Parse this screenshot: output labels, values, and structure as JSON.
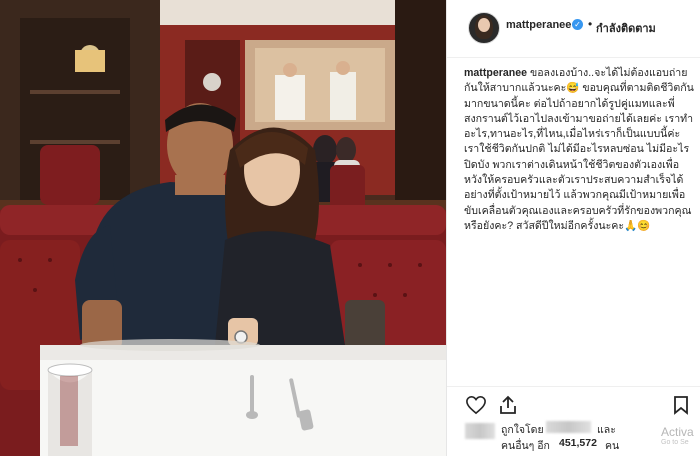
{
  "post": {
    "username": "mattperanee",
    "follow_status": "กำลังติดตาม",
    "caption_user": "mattperanee",
    "caption_lines": [
      "ขอลงเองบ้าง..จะได้ไม่ต้องแอบถ่าย",
      "กันให้สาบากแล้วนะคะ😅 ขอบคุณที่ตามติดชีวิตกัน",
      "มากขนาดนี้คะ ต่อไปถ้าอยากได้รูปคู่แมทและพี่",
      "สงกรานต์ไว้เอาไปลงเข้ามาขอถ่ายได้เลยค่ะ เราทำ",
      "อะไร,ทานอะไร,ที่ไหน,เมื่อไหร่เราก็เป็นแบบนี้ค่ะ",
      "เราใช้ชีวิตกันปกติ ไม่ได้มีอะไรหลบซ่อน ไม่มีอะไร",
      "ปิดบัง พวกเราต่างเดินหน้าใช้ชีวิตของตัวเองเพื่อ",
      "หวังให้ครอบครัวและตัวเราประสบความสำเร็จได้",
      "อย่างที่ตั้งเป้าหมายไว้ แล้วพวกคุณมีเป้าหมายเพื่อ",
      "ขับเคลื่อนตัวคุณเองและครอบครัวที่รักของพวกคุณ",
      "หรือยังคะ? สวัสดีปีใหม่อีกครั้งนะคะ🙏😊"
    ]
  },
  "likes": {
    "line1_prefix": "ถูกใจโดย",
    "line1_suffix": "และ",
    "line2_prefix": "คนอื่นๆ อีก",
    "count": "451,572",
    "line2_suffix": "คน"
  },
  "watermark": {
    "line1": "Activa",
    "line2": "Go to Se"
  },
  "icons": {
    "verified": "verified-badge-icon",
    "like": "heart-icon",
    "share": "share-icon",
    "save": "bookmark-icon"
  },
  "colors": {
    "verified_blue": "#3897f0",
    "text": "#262626",
    "wall_red": "#8b2a22",
    "sofa_red": "#8a1f22"
  }
}
